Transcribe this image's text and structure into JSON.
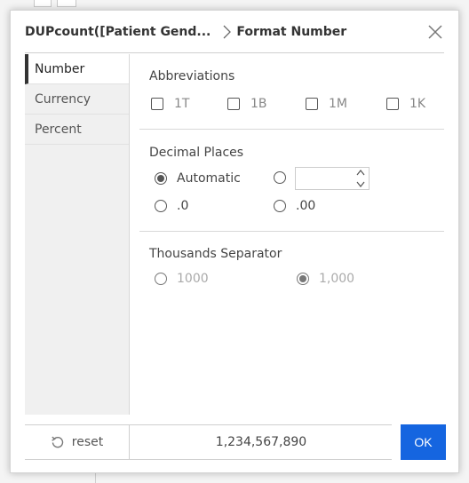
{
  "header": {
    "title": "DUPcount([Patient Gend...",
    "subtitle": "Format Number"
  },
  "sidebar": {
    "items": [
      {
        "label": "Number",
        "active": true
      },
      {
        "label": "Currency",
        "active": false
      },
      {
        "label": "Percent",
        "active": false
      }
    ]
  },
  "abbreviations": {
    "title": "Abbreviations",
    "options": [
      {
        "label": "1T",
        "checked": false
      },
      {
        "label": "1B",
        "checked": false
      },
      {
        "label": "1M",
        "checked": false
      },
      {
        "label": "1K",
        "checked": false
      }
    ]
  },
  "decimal_places": {
    "title": "Decimal Places",
    "automatic_label": "Automatic",
    "custom_value": "",
    "one_label": ".0",
    "two_label": ".00",
    "selected": "Automatic"
  },
  "thousands_separator": {
    "title": "Thousands Separator",
    "none_label": "1000",
    "comma_label": "1,000",
    "selected": "1,000"
  },
  "footer": {
    "reset_label": "reset",
    "preview_value": "1,234,567,890",
    "ok_label": "OK"
  },
  "colors": {
    "accent": "#1565e0",
    "sidebar_bg": "#f0f0f0",
    "active_marker": "#333333"
  },
  "icons": {
    "breadcrumb": "chevron-right-icon",
    "close": "close-icon",
    "reset": "reset-icon",
    "spin_up": "chevron-up-icon",
    "spin_down": "chevron-down-icon"
  }
}
